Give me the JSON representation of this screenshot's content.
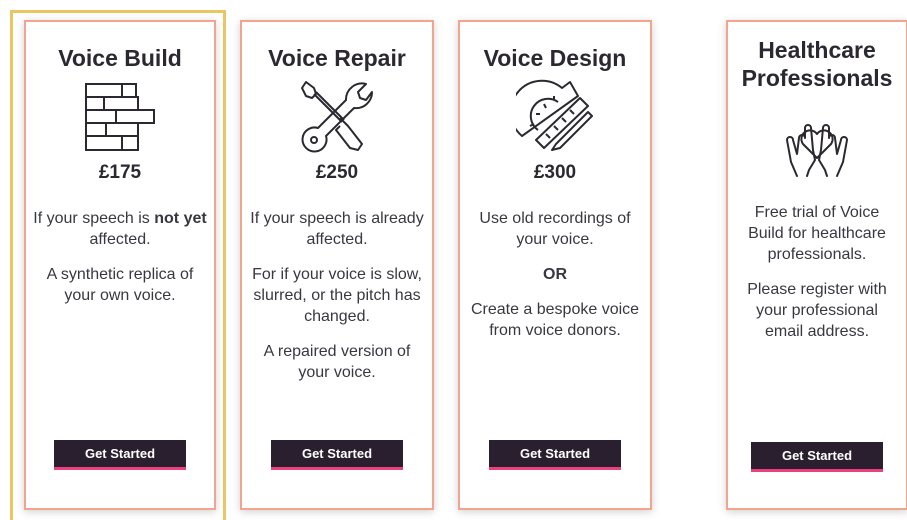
{
  "cards": [
    {
      "title": "Voice Build",
      "icon": "brick-wall-icon",
      "price": "£175",
      "p1_pre": "If your speech is ",
      "p1_bold": "not yet",
      "p1_post": " affected.",
      "p2": "A synthetic replica of your own voice.",
      "button": "Get Started",
      "selected": true
    },
    {
      "title": "Voice Repair",
      "icon": "wrench-screwdriver-icon",
      "price": "£250",
      "p1": "If your speech is already affected.",
      "p2": "For if your voice is slow, slurred, or the pitch has changed.",
      "p3": "A repaired version of your voice.",
      "button": "Get Started"
    },
    {
      "title": "Voice Design",
      "icon": "protractor-pencil-icon",
      "price": "£300",
      "p1": "Use old recordings of your voice.",
      "or": "OR",
      "p2": "Create a bespoke voice from voice donors.",
      "button": "Get Started"
    },
    {
      "title": "Healthcare Professionals",
      "icon": "hands-heart-icon",
      "p1": "Free trial of Voice Build for healthcare professionals.",
      "p2": "Please register with your professional email address.",
      "button": "Get Started"
    }
  ],
  "colors": {
    "card_border": "#f2a58e",
    "selected_outline": "#e8c660",
    "button_bg": "#2a1f2f",
    "button_accent": "#e8417e"
  }
}
